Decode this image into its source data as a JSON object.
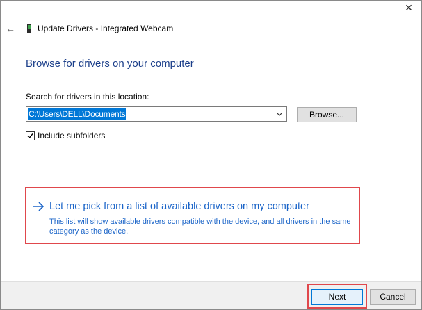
{
  "window": {
    "title": "Update Drivers - Integrated Webcam",
    "close_glyph": "✕",
    "back_glyph": "←"
  },
  "main": {
    "heading": "Browse for drivers on your computer",
    "search_label": "Search for drivers in this location:",
    "path_value": "C:\\Users\\DELL\\Documents",
    "browse_label": "Browse...",
    "include_subfolders_label": "Include subfolders",
    "include_subfolders_checked": true,
    "pick_link_title": "Let me pick from a list of available drivers on my computer",
    "pick_link_desc": "This list will show available drivers compatible with the device, and all drivers in the same category as the device."
  },
  "footer": {
    "next_label": "Next",
    "cancel_label": "Cancel"
  },
  "colors": {
    "heading": "#1c3f8a",
    "link": "#1a64c8",
    "highlight_outline": "#e0474c",
    "selection": "#0078d7"
  },
  "icons": {
    "back": "arrow-left-icon",
    "device": "webcam-device-icon",
    "close": "close-icon",
    "dropdown": "chevron-down-icon",
    "check": "checkmark-icon",
    "link_arrow": "arrow-right-icon"
  }
}
